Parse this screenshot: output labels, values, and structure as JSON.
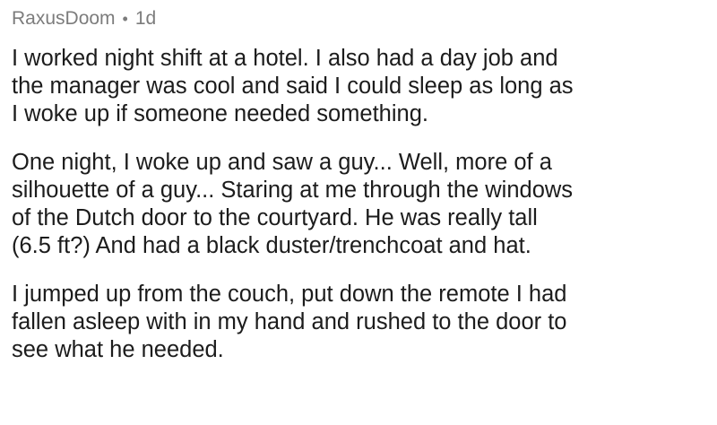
{
  "comment": {
    "author": "RaxusDoom",
    "separator": "•",
    "age": "1d",
    "paragraphs": [
      "I worked night shift at a hotel. I also had a day job and\nthe manager was cool and said I could sleep as long as\nI woke up if someone needed something.",
      "One night, I woke up and saw a guy... Well, more of a\nsilhouette of a guy... Staring at me through the windows\nof the Dutch door to the courtyard. He was really tall\n(6.5 ft?) And had a black duster/trenchcoat and hat.",
      "I jumped up from the couch, put down the remote I had\nfallen asleep with in my hand and rushed to the door to\nsee what he needed."
    ]
  }
}
